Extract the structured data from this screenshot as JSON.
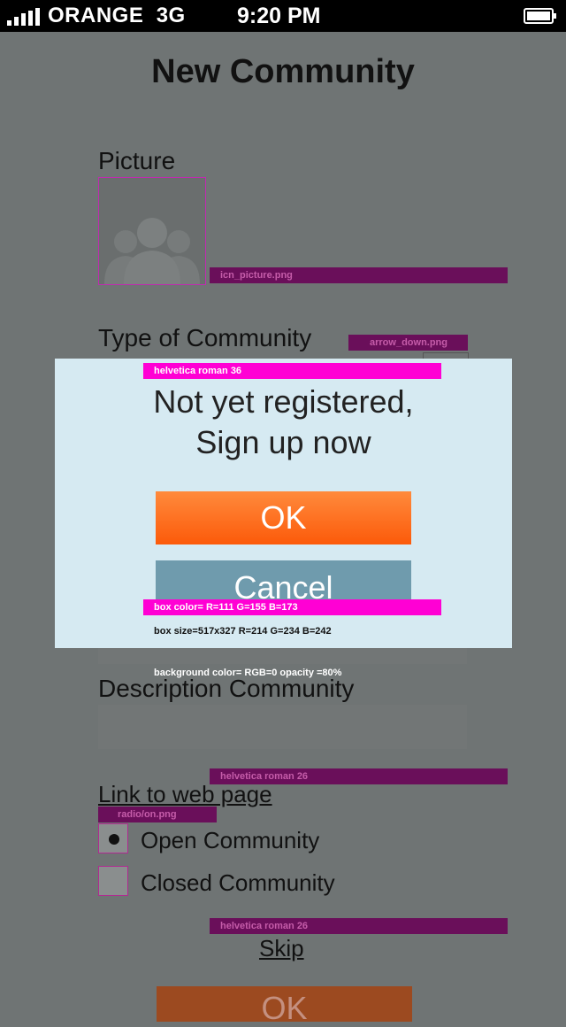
{
  "status_bar": {
    "carrier": "ORANGE",
    "network": "3G",
    "time": "9:20 PM"
  },
  "form": {
    "title": "New Community",
    "picture_label": "Picture",
    "picture_tag": "icn_picture.png",
    "type_label": "Type of Community",
    "type_tag": "arrow_down.png",
    "description_label": "Description Community",
    "tag_font_1": "helvetica roman 26",
    "link_label": "Link to web page",
    "radio_tag": "radio/on.png",
    "radio_options": [
      "Open Community",
      "Closed Community"
    ],
    "radio_selected": "Open Community",
    "tag_font_2": "helvetica roman 26",
    "skip_label": "Skip",
    "ok_label": "OK"
  },
  "dialog": {
    "font_note": "helvetica roman 36",
    "message_line1": "Not yet registered,",
    "message_line2": "Sign up now",
    "ok_label": "OK",
    "cancel_label": "Cancel",
    "box_color_note": "box color= R=111 G=155 B=173",
    "box_size_note": "box size=517x327 R=214 G=234 B=242",
    "background_note": "background color= RGB=0 opacity =80%"
  },
  "colors": {
    "ok_button": "#fc6a1c",
    "cancel_button": "#6f9bad",
    "dialog_background": "#d6eaf2",
    "annotation_magenta": "#ff00d4"
  }
}
